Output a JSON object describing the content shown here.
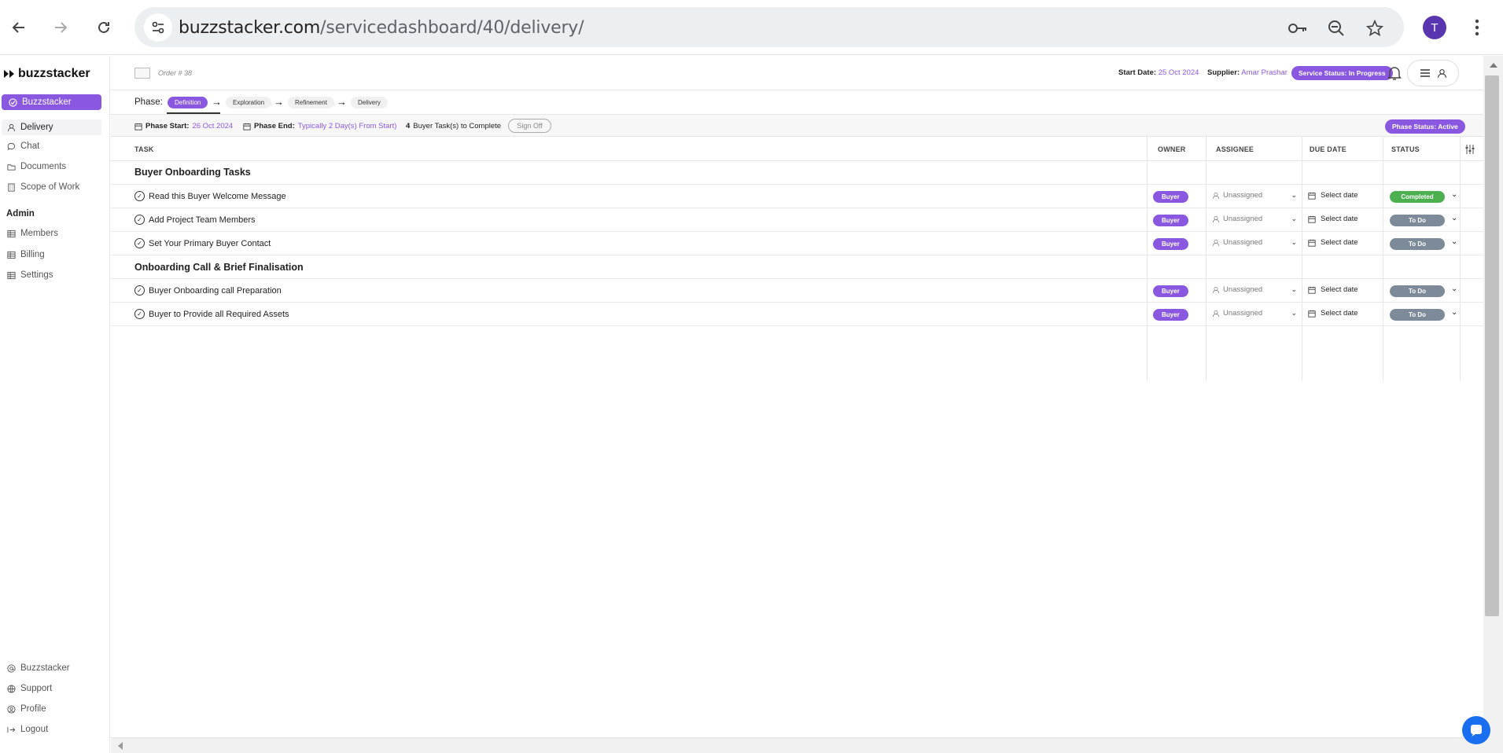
{
  "browser": {
    "url_host": "buzzstacker.com",
    "url_path": "/servicedashboard/40/delivery/",
    "avatar_letter": "T"
  },
  "sidebar": {
    "logo_text": "buzzstacker",
    "active_item": "Buzzstacker",
    "items": [
      {
        "label": "Delivery",
        "icon": "user-icon"
      },
      {
        "label": "Chat",
        "icon": "chat-icon"
      },
      {
        "label": "Documents",
        "icon": "folder-icon"
      },
      {
        "label": "Scope of Work",
        "icon": "building-icon"
      }
    ],
    "admin_heading": "Admin",
    "admin_items": [
      {
        "label": "Members",
        "icon": "table-icon"
      },
      {
        "label": "Billing",
        "icon": "table-icon"
      },
      {
        "label": "Settings",
        "icon": "table-icon"
      }
    ],
    "bottom_items": [
      {
        "label": "Buzzstacker",
        "icon": "at-icon"
      },
      {
        "label": "Support",
        "icon": "globe-icon"
      },
      {
        "label": "Profile",
        "icon": "profile-icon"
      },
      {
        "label": "Logout",
        "icon": "logout-icon"
      }
    ]
  },
  "header": {
    "order": "Order # 38",
    "start_date_label": "Start Date:",
    "start_date": "25 Oct 2024",
    "supplier_label": "Supplier:",
    "supplier": "Amar Prashar",
    "service_status": "Service Status: In Progress"
  },
  "phase": {
    "label": "Phase:",
    "phases": [
      "Definition",
      "Exploration",
      "Refinement",
      "Delivery"
    ],
    "active": "Definition"
  },
  "info": {
    "phase_start_label": "Phase Start:",
    "phase_start": "26 Oct 2024",
    "phase_end_label": "Phase End:",
    "phase_end": "Typically 2 Day(s) From Start)",
    "task_count": "4",
    "task_text": "Buyer Task(s) to Complete",
    "sign_off": "Sign Off",
    "phase_status": "Phase Status: Active"
  },
  "table": {
    "headers": {
      "task": "TASK",
      "owner": "OWNER",
      "assignee": "ASSIGNEE",
      "due": "DUE DATE",
      "status": "STATUS"
    },
    "groups": [
      {
        "title": "Buyer Onboarding Tasks",
        "rows": [
          {
            "task": "Read this Buyer Welcome Message",
            "owner": "Buyer",
            "assignee": "Unassigned",
            "due": "Select date",
            "status": "Completed"
          },
          {
            "task": "Add Project Team Members",
            "owner": "Buyer",
            "assignee": "Unassigned",
            "due": "Select date",
            "status": "To Do"
          },
          {
            "task": "Set Your Primary Buyer Contact",
            "owner": "Buyer",
            "assignee": "Unassigned",
            "due": "Select date",
            "status": "To Do"
          }
        ]
      },
      {
        "title": "Onboarding Call & Brief Finalisation",
        "rows": [
          {
            "task": "Buyer Onboarding call Preparation",
            "owner": "Buyer",
            "assignee": "Unassigned",
            "due": "Select date",
            "status": "To Do"
          },
          {
            "task": "Buyer to Provide all Required Assets",
            "owner": "Buyer",
            "assignee": "Unassigned",
            "due": "Select date",
            "status": "To Do"
          }
        ]
      }
    ]
  },
  "colors": {
    "accent": "#8a58e0",
    "completed": "#4caf50",
    "todo": "#7d8a99"
  }
}
